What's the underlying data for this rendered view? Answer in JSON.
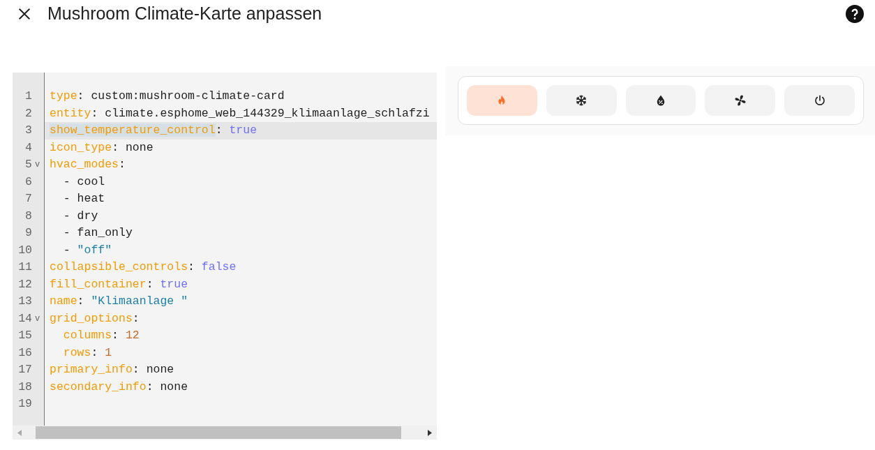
{
  "dialog": {
    "title": "Mushroom Climate-Karte anpassen"
  },
  "editor": {
    "lines": [
      {
        "number": "1",
        "tokens": [
          {
            "kind": "key",
            "text": "type"
          },
          {
            "kind": "plain",
            "text": ": custom:mushroom-climate-card"
          }
        ]
      },
      {
        "number": "2",
        "tokens": [
          {
            "kind": "key",
            "text": "entity"
          },
          {
            "kind": "plain",
            "text": ": climate.esphome_web_144329_klimaanlage_schlafzi"
          }
        ]
      },
      {
        "number": "3",
        "active": true,
        "tokens": [
          {
            "kind": "key",
            "text": "show_temperature_control",
            "selected": true
          },
          {
            "kind": "plain",
            "text": ": "
          },
          {
            "kind": "bool",
            "text": "true"
          }
        ]
      },
      {
        "number": "4",
        "tokens": [
          {
            "kind": "key",
            "text": "icon_type"
          },
          {
            "kind": "plain",
            "text": ": none"
          }
        ]
      },
      {
        "number": "5",
        "fold": "v",
        "tokens": [
          {
            "kind": "key",
            "text": "hvac_modes"
          },
          {
            "kind": "plain",
            "text": ":"
          }
        ]
      },
      {
        "number": "6",
        "tokens": [
          {
            "kind": "plain",
            "text": "  - cool"
          }
        ]
      },
      {
        "number": "7",
        "tokens": [
          {
            "kind": "plain",
            "text": "  - heat"
          }
        ]
      },
      {
        "number": "8",
        "tokens": [
          {
            "kind": "plain",
            "text": "  - dry"
          }
        ]
      },
      {
        "number": "9",
        "tokens": [
          {
            "kind": "plain",
            "text": "  - fan_only"
          }
        ]
      },
      {
        "number": "10",
        "tokens": [
          {
            "kind": "plain",
            "text": "  - "
          },
          {
            "kind": "string",
            "text": "\"off\""
          }
        ]
      },
      {
        "number": "11",
        "tokens": [
          {
            "kind": "key",
            "text": "collapsible_controls"
          },
          {
            "kind": "plain",
            "text": ": "
          },
          {
            "kind": "bool",
            "text": "false"
          }
        ]
      },
      {
        "number": "12",
        "tokens": [
          {
            "kind": "key",
            "text": "fill_container"
          },
          {
            "kind": "plain",
            "text": ": "
          },
          {
            "kind": "bool",
            "text": "true"
          }
        ]
      },
      {
        "number": "13",
        "tokens": [
          {
            "kind": "key",
            "text": "name"
          },
          {
            "kind": "plain",
            "text": ": "
          },
          {
            "kind": "string",
            "text": "\"Klimaanlage \""
          }
        ]
      },
      {
        "number": "14",
        "fold": "v",
        "tokens": [
          {
            "kind": "key",
            "text": "grid_options"
          },
          {
            "kind": "plain",
            "text": ":"
          }
        ]
      },
      {
        "number": "15",
        "indent": true,
        "tokens": [
          {
            "kind": "key",
            "text": "columns"
          },
          {
            "kind": "plain",
            "text": ": "
          },
          {
            "kind": "number",
            "text": "12"
          }
        ]
      },
      {
        "number": "16",
        "indent": true,
        "tokens": [
          {
            "kind": "key",
            "text": "rows"
          },
          {
            "kind": "plain",
            "text": ": "
          },
          {
            "kind": "number",
            "text": "1"
          }
        ]
      },
      {
        "number": "17",
        "tokens": [
          {
            "kind": "key",
            "text": "primary_info"
          },
          {
            "kind": "plain",
            "text": ": none"
          }
        ]
      },
      {
        "number": "18",
        "tokens": [
          {
            "kind": "key",
            "text": "secondary_info"
          },
          {
            "kind": "plain",
            "text": ": none"
          }
        ]
      },
      {
        "number": "19"
      }
    ]
  },
  "preview": {
    "modes": [
      {
        "kind": "heat",
        "selected": true
      },
      {
        "kind": "cool",
        "selected": false
      },
      {
        "kind": "dry",
        "selected": false
      },
      {
        "kind": "fan_only",
        "selected": false
      },
      {
        "kind": "off",
        "selected": false
      }
    ]
  }
}
